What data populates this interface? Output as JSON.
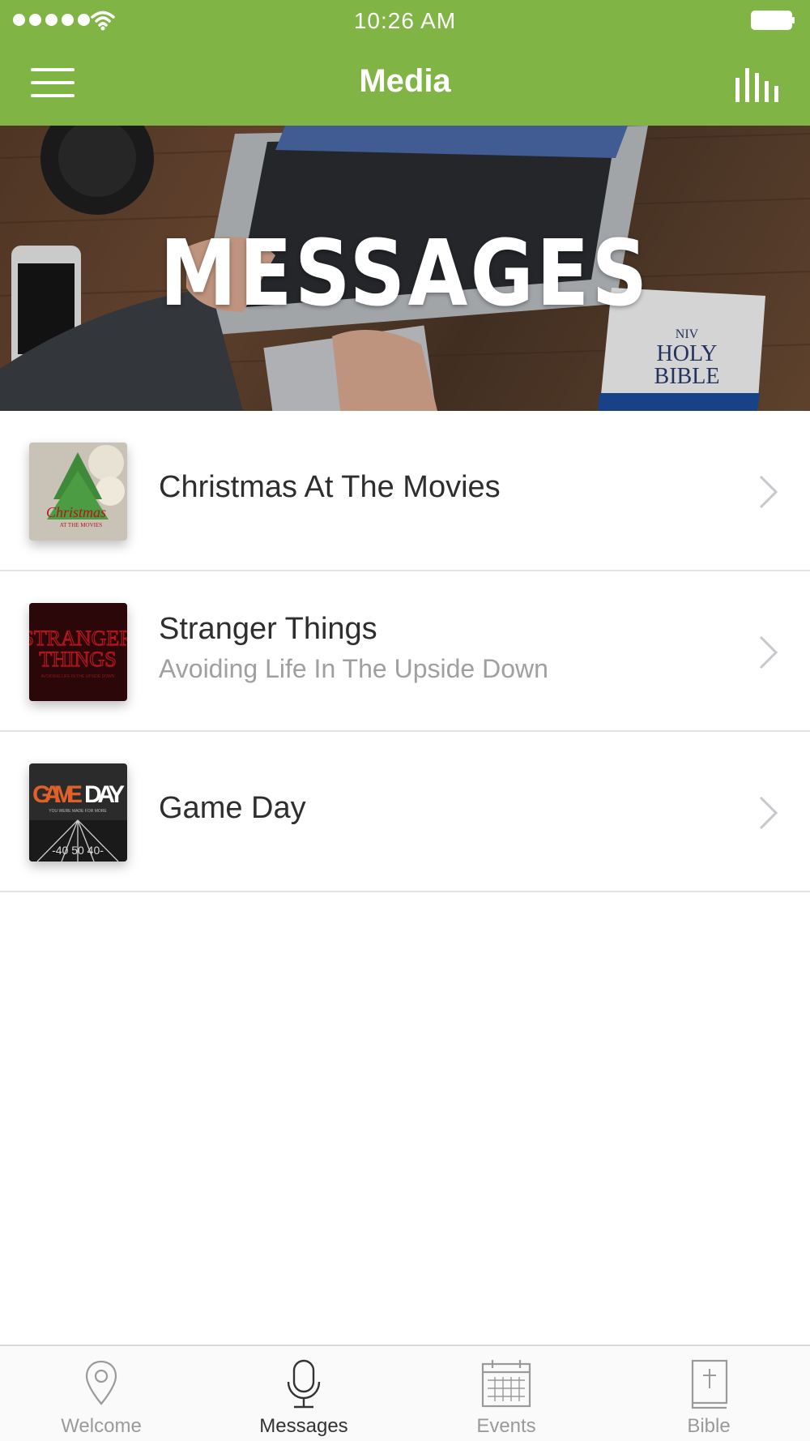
{
  "status_bar": {
    "time": "10:26 AM"
  },
  "nav": {
    "title": "Media"
  },
  "hero": {
    "title": "MESSAGES"
  },
  "series": [
    {
      "title": "Christmas At The Movies",
      "subtitle": ""
    },
    {
      "title": "Stranger Things",
      "subtitle": "Avoiding Life In The Upside Down"
    },
    {
      "title": "Game Day",
      "subtitle": ""
    }
  ],
  "tabs": [
    {
      "label": "Welcome",
      "icon": "location-pin-icon",
      "active": false
    },
    {
      "label": "Messages",
      "icon": "microphone-icon",
      "active": true
    },
    {
      "label": "Events",
      "icon": "calendar-icon",
      "active": false
    },
    {
      "label": "Bible",
      "icon": "bible-icon",
      "active": false
    }
  ],
  "colors": {
    "accent": "#80b545",
    "text": "#2e2e2e",
    "subtext": "#a0a0a0"
  }
}
